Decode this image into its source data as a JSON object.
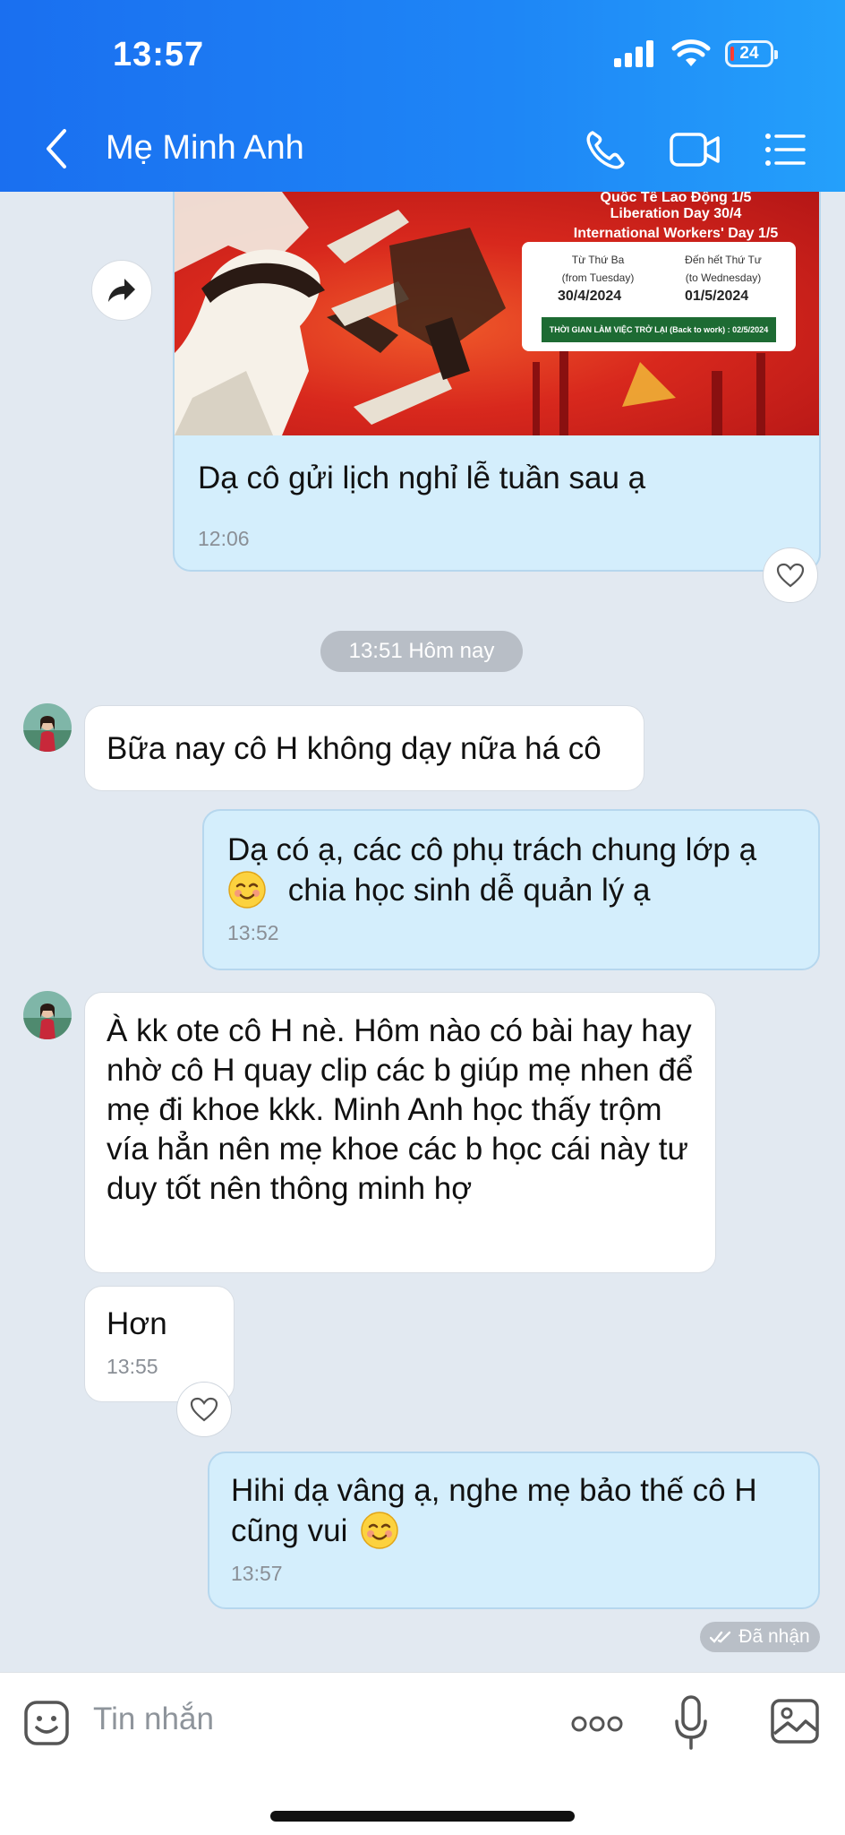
{
  "status_bar": {
    "time": "13:57",
    "battery": "24"
  },
  "header": {
    "title": "Mẹ Minh Anh"
  },
  "image_message": {
    "poster_lines": [
      "Quốc Tế Lao Động 1/5",
      "Liberation Day 30/4",
      "International Workers' Day 1/5"
    ],
    "from_label": "Từ Thứ Ba",
    "from_sub": "(from Tuesday)",
    "from_date": "30/4/2024",
    "to_label": "Đến hết Thứ Tư",
    "to_sub": "(to Wednesday)",
    "to_date": "01/5/2024",
    "back_to_work": "THỜI GIAN LÀM VIỆC TRỞ LẠI (Back to work) : 02/5/2024",
    "caption": "Dạ cô gửi lịch nghỉ lễ tuần sau ạ",
    "time": "12:06"
  },
  "date_separator": "13:51 Hôm nay",
  "messages": [
    {
      "text": "Bữa nay cô H không dạy nữa há cô"
    },
    {
      "line1": "Dạ có ạ, các cô phụ trách chung lớp ạ",
      "line2": "chia học sinh dễ quản lý ạ",
      "time": "13:52"
    },
    {
      "text": "À kk ote cô H nè. Hôm nào có bài hay hay nhờ cô H quay clip các b giúp mẹ nhen để mẹ đi khoe kkk. Minh Anh học thấy trộm vía hẳn nên mẹ khoe các b học cái này tư duy tốt nên thông minh hợ"
    },
    {
      "text": "Hơn",
      "time": "13:55"
    },
    {
      "line1": "Hihi dạ vâng ạ, nghe mẹ bảo thế cô H",
      "line2": "cũng vui",
      "time": "13:57"
    }
  ],
  "received_label": "Đã nhận",
  "input": {
    "placeholder": "Tin nhắn"
  },
  "icons": [
    "back-icon",
    "phone-icon",
    "video-icon",
    "menu-icon",
    "forward-icon",
    "heart-icon",
    "sticker-icon",
    "more-icon",
    "mic-icon",
    "image-icon"
  ],
  "colors": {
    "header_start": "#1a6ff0",
    "header_end": "#24a0fb",
    "outgoing_bubble": "#d4eefc",
    "incoming_bubble": "#ffffff",
    "background": "#e2e9f1"
  }
}
